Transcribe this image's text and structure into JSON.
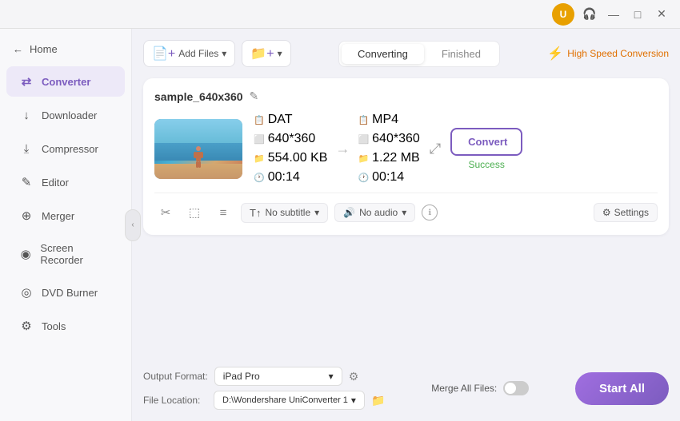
{
  "titlebar": {
    "user_icon_label": "U",
    "headphone_icon": "headphone",
    "minimize_icon": "—",
    "maximize_icon": "□",
    "close_icon": "✕"
  },
  "sidebar": {
    "home_label": "Home",
    "items": [
      {
        "id": "converter",
        "label": "Converter",
        "icon": "⇄",
        "active": true
      },
      {
        "id": "downloader",
        "label": "Downloader",
        "icon": "↓"
      },
      {
        "id": "compressor",
        "label": "Compressor",
        "icon": "⤓"
      },
      {
        "id": "editor",
        "label": "Editor",
        "icon": "✎"
      },
      {
        "id": "merger",
        "label": "Merger",
        "icon": "⊕"
      },
      {
        "id": "screen-recorder",
        "label": "Screen Recorder",
        "icon": "◉"
      },
      {
        "id": "dvd-burner",
        "label": "DVD Burner",
        "icon": "◎"
      },
      {
        "id": "tools",
        "label": "Tools",
        "icon": "⚙"
      }
    ]
  },
  "toolbar": {
    "add_file_label": "Add Files",
    "add_folder_label": "Add Folder"
  },
  "tabs": {
    "converting_label": "Converting",
    "finished_label": "Finished",
    "active": "Converting"
  },
  "high_speed": {
    "label": "High Speed Conversion"
  },
  "file": {
    "name": "sample_640x360",
    "source": {
      "format": "DAT",
      "resolution": "640*360",
      "size": "554.00 KB",
      "duration": "00:14"
    },
    "target": {
      "format": "MP4",
      "resolution": "640*360",
      "size": "1.22 MB",
      "duration": "00:14"
    },
    "convert_btn_label": "Convert",
    "success_label": "Success"
  },
  "tools": {
    "subtitle_label": "No subtitle",
    "audio_label": "No audio",
    "settings_label": "Settings"
  },
  "bottom": {
    "output_format_label": "Output Format:",
    "output_format_value": "iPad Pro",
    "file_location_label": "File Location:",
    "file_location_value": "D:\\Wondershare UniConverter 1",
    "merge_label": "Merge All Files:",
    "start_all_label": "Start All"
  }
}
